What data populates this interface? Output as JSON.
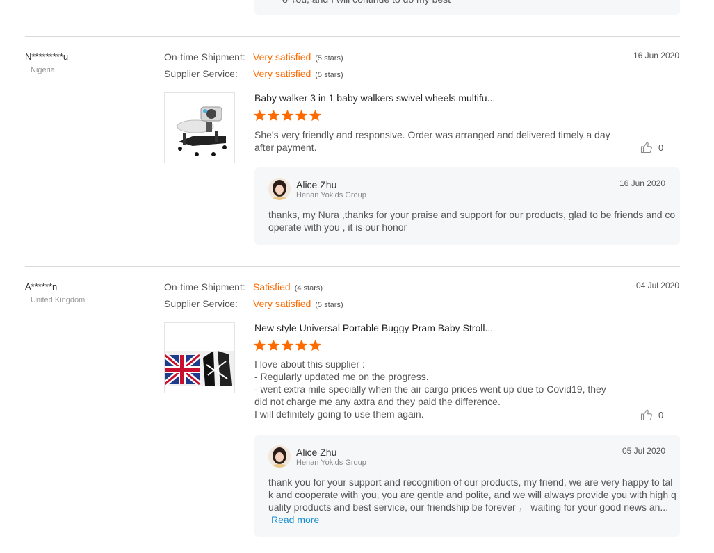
{
  "top_reply": {
    "visible_text": "o You, and I will continue to do my best",
    "faded_tail": "♡♡♡♡"
  },
  "reviews": [
    {
      "buyer": {
        "name": "N*********u",
        "country": "Nigeria"
      },
      "date": "16 Jun 2020",
      "shipment": {
        "label": "On-time Shipment:",
        "value": "Very satisfied",
        "note": "(5 stars)"
      },
      "service": {
        "label": "Supplier Service:",
        "value": "Very satisfied",
        "note": "(5 stars)"
      },
      "product_title": "Baby walker 3 in 1 baby walkers swivel wheels multifu...",
      "rating": 5,
      "text_lines": [
        "She's very friendly and responsive. Order was arranged and delivered timely a day",
        "after payment."
      ],
      "likes": "0",
      "reply": {
        "name": "Alice Zhu",
        "company": "Henan Yokids Group",
        "date": "16 Jun 2020",
        "text_lines": [
          "thanks, my Nura ,thanks for your praise and support for our products, glad to be friends and co",
          "operate with you , it is our honor"
        ]
      }
    },
    {
      "buyer": {
        "name": "A******n",
        "country": "United Kingdom"
      },
      "date": "04 Jul 2020",
      "shipment": {
        "label": "On-time Shipment:",
        "value": "Satisfied",
        "note": "(4 stars)"
      },
      "service": {
        "label": "Supplier Service:",
        "value": "Very satisfied",
        "note": "(5 stars)"
      },
      "product_title": "New style Universal Portable Buggy Pram Baby Stroll...",
      "rating": 5,
      "text_lines": [
        "I love about this supplier :",
        "- Regularly updated me on the progress.",
        "- went extra mile specially when the air cargo prices went up due to Covid19, they",
        "did not charge me any axtra and they paid the difference.",
        "I will definitely going to use them again."
      ],
      "likes": "0",
      "reply": {
        "name": "Alice Zhu",
        "company": "Henan Yokids Group",
        "date": "05 Jul 2020",
        "text_lines": [
          "thank you for your support and recognition of our products, my friend, we are very happy to tal",
          "k and cooperate with you, you are gentle and polite, and we will always provide you with high q",
          "uality products and best service, our friendship be forever ， waiting for your good news an..."
        ],
        "read_more": "Read more"
      }
    }
  ],
  "colors": {
    "accent": "#ff6a00",
    "link": "#1a8fd0",
    "reply_bg": "#f6f7f9"
  },
  "icons": {
    "star": "star-icon",
    "like": "thumbs-up-icon"
  }
}
